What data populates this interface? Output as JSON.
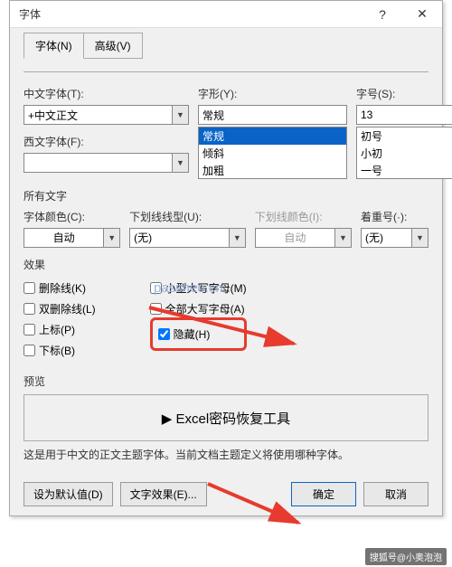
{
  "titlebar": {
    "title": "字体"
  },
  "tabs": {
    "font": "字体(N)",
    "advanced": "高级(V)"
  },
  "labels": {
    "cnfont": "中文字体(T):",
    "wfont": "西文字体(F):",
    "style": "字形(Y):",
    "size": "字号(S):",
    "alltext": "所有文字",
    "fontcolor": "字体颜色(C):",
    "ultype": "下划线线型(U):",
    "ulcolor": "下划线颜色(I):",
    "emphasis": "着重号(·):",
    "effects": "效果",
    "preview": "预览"
  },
  "values": {
    "cnfont": "+中文正文",
    "wfont": "",
    "style": "常规",
    "size": "13",
    "fontcolor": "自动",
    "ultype": "(无)",
    "ulcolor": "自动",
    "emphasis": "(无)"
  },
  "styleList": [
    "常规",
    "倾斜",
    "加粗"
  ],
  "sizeList": [
    "初号",
    "小初",
    "一号"
  ],
  "effectsLeft": {
    "strike": "删除线(K)",
    "dstrike": "双删除线(L)",
    "sup": "上标(P)",
    "sub": "下标(B)"
  },
  "effectsRight": {
    "smallcaps": "小型大写字母(M)",
    "allcaps": "全部大写字母(A)",
    "hidden": "隐藏(H)"
  },
  "previewText": "▶  Excel密码恢复工具",
  "desc": "这是用于中文的正文主题字体。当前文档主题定义将使用哪种字体。",
  "buttons": {
    "default": "设为默认值(D)",
    "texteffects": "文字效果(E)...",
    "ok": "确定",
    "cancel": "取消"
  },
  "watermark": "passneo.cn",
  "credit": "搜狐号@小奥泡泡"
}
